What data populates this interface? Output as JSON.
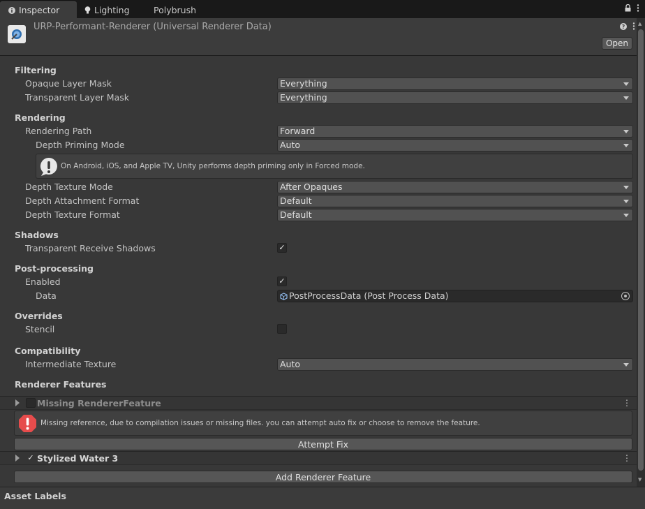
{
  "tabs": [
    {
      "label": "Inspector",
      "icon": "info-icon",
      "active": true
    },
    {
      "label": "Lighting",
      "icon": "lightbulb-icon",
      "active": false
    },
    {
      "label": "Polybrush",
      "icon": "",
      "active": false
    }
  ],
  "header": {
    "title": "URP-Performant-Renderer (Universal Renderer Data)",
    "open_label": "Open",
    "asset_icon": "renderer-asset-icon"
  },
  "sections": {
    "filtering": "Filtering",
    "rendering": "Rendering",
    "shadows": "Shadows",
    "post_processing": "Post-processing",
    "overrides": "Overrides",
    "compatibility": "Compatibility",
    "renderer_features": "Renderer Features"
  },
  "fields": {
    "opaque_layer_mask": {
      "label": "Opaque Layer Mask",
      "value": "Everything"
    },
    "transparent_layer_mask": {
      "label": "Transparent Layer Mask",
      "value": "Everything"
    },
    "rendering_path": {
      "label": "Rendering Path",
      "value": "Forward"
    },
    "depth_priming_mode": {
      "label": "Depth Priming Mode",
      "value": "Auto"
    },
    "depth_priming_help": "On Android, iOS, and Apple TV, Unity performs depth priming only in Forced mode.",
    "depth_texture_mode": {
      "label": "Depth Texture Mode",
      "value": "After Opaques"
    },
    "depth_attachment_format": {
      "label": "Depth Attachment Format",
      "value": "Default"
    },
    "depth_texture_format": {
      "label": "Depth Texture Format",
      "value": "Default"
    },
    "transparent_receive_shadows": {
      "label": "Transparent Receive Shadows",
      "checked": true
    },
    "pp_enabled": {
      "label": "Enabled",
      "checked": true
    },
    "pp_data": {
      "label": "Data",
      "value": "PostProcessData (Post Process Data)"
    },
    "stencil": {
      "label": "Stencil",
      "checked": false
    },
    "intermediate_texture": {
      "label": "Intermediate Texture",
      "value": "Auto"
    }
  },
  "features": {
    "missing": {
      "name": "Missing RendererFeature",
      "enabled": false
    },
    "missing_help": "Missing reference, due to compilation issues or missing files. you can attempt auto fix or choose to remove the feature.",
    "attempt_fix_label": "Attempt Fix",
    "stylized_water": {
      "name": "Stylized Water 3",
      "enabled": true
    },
    "add_feature_label": "Add Renderer Feature"
  },
  "asset_labels": "Asset Labels",
  "colors": {
    "error_red": "#e64c4c",
    "panel_bg": "#383838"
  }
}
